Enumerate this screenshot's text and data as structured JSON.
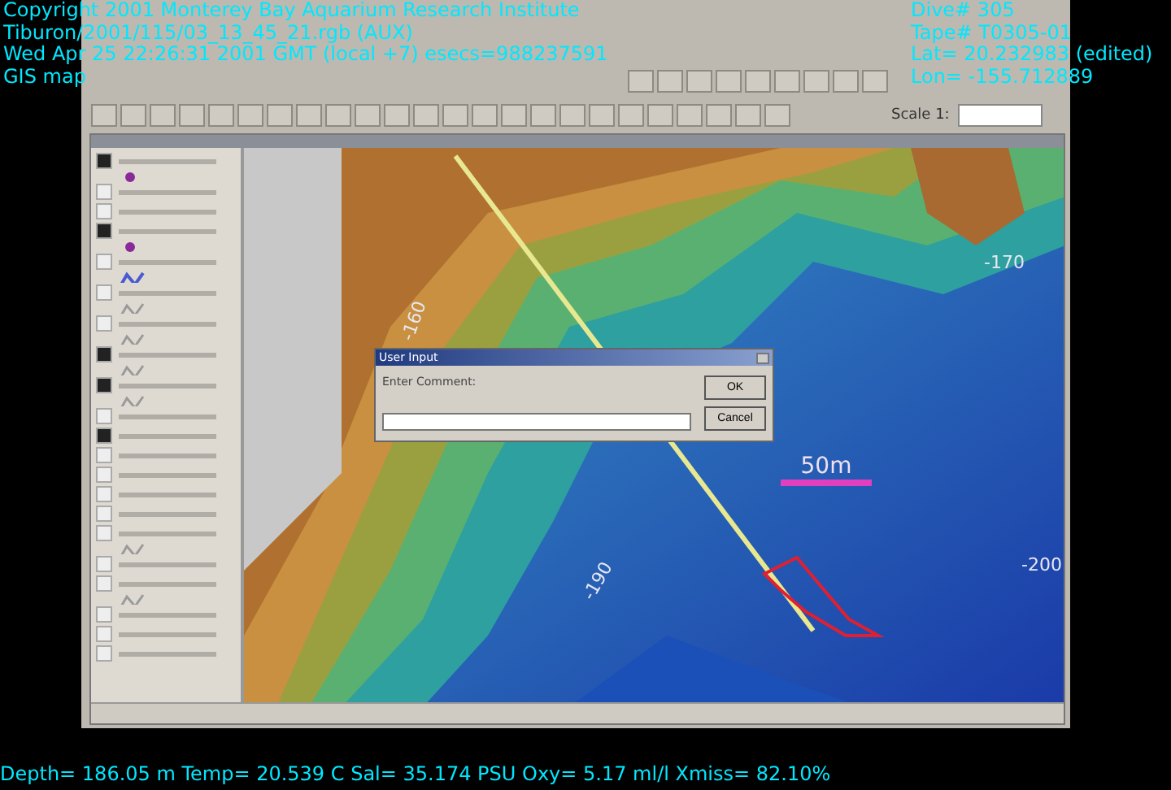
{
  "overlay": {
    "top_left": [
      "Copyright 2001 Monterey Bay Aquarium Research Institute",
      "Tiburon/2001/115/03_13_45_21.rgb (AUX)",
      "Wed Apr 25 22:26:31 2001 GMT (local +7)  esecs=988237591",
      "GIS map"
    ],
    "top_right": [
      "Dive# 305",
      "Tape# T0305-01",
      "Lat= 20.232983 (edited)",
      "Lon= -155.712889"
    ],
    "bottom": "Depth= 186.05 m  Temp= 20.539 C  Sal= 35.174 PSU  Oxy= 5.17 ml/l  Xmiss= 82.10%"
  },
  "toolbar": {
    "scale_label": "Scale 1:"
  },
  "overview": {
    "layers": [
      {
        "checked": true,
        "kind": "point"
      },
      {
        "checked": false,
        "kind": "plain"
      },
      {
        "checked": false,
        "kind": "plain"
      },
      {
        "checked": true,
        "kind": "point"
      },
      {
        "checked": false,
        "kind": "blueline"
      },
      {
        "checked": false,
        "kind": "line"
      },
      {
        "checked": false,
        "kind": "line"
      },
      {
        "checked": true,
        "kind": "line"
      },
      {
        "checked": true,
        "kind": "line"
      },
      {
        "checked": false,
        "kind": "plain"
      },
      {
        "checked": true,
        "kind": "plain"
      },
      {
        "checked": false,
        "kind": "plain"
      },
      {
        "checked": false,
        "kind": "plain"
      },
      {
        "checked": false,
        "kind": "plain"
      },
      {
        "checked": false,
        "kind": "plain"
      },
      {
        "checked": false,
        "kind": "line"
      },
      {
        "checked": false,
        "kind": "plain"
      },
      {
        "checked": false,
        "kind": "line"
      },
      {
        "checked": false,
        "kind": "plain"
      },
      {
        "checked": false,
        "kind": "plain"
      },
      {
        "checked": false,
        "kind": "plain"
      }
    ]
  },
  "map": {
    "scale_bar": "50m",
    "contour_labels": [
      "-170",
      "-160",
      "-190",
      "-200"
    ]
  },
  "dialog": {
    "title": "User Input",
    "prompt": "Enter Comment:",
    "buttons": [
      "OK",
      "Cancel"
    ]
  }
}
